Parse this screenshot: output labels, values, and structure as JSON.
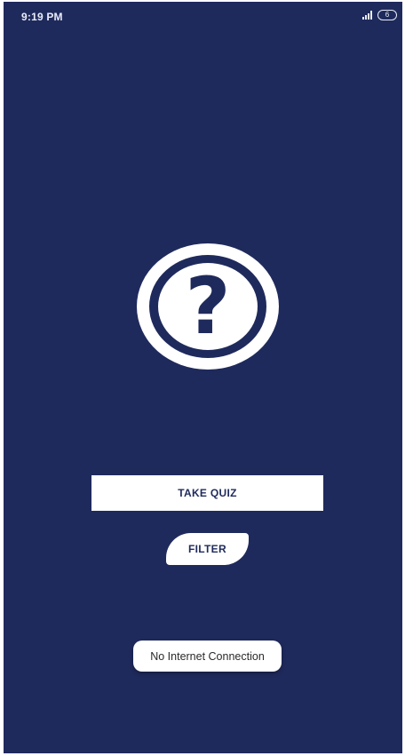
{
  "status_bar": {
    "time": "9:19 PM",
    "battery_level": "6",
    "signal_icon": "signal-bars-icon",
    "battery_icon": "battery-icon"
  },
  "logo": {
    "icon": "question-mark-icon",
    "glyph": "?"
  },
  "actions": {
    "take_quiz_label": "TAKE QUIZ",
    "filter_label": "FILTER"
  },
  "toast": {
    "message": "No Internet Connection"
  },
  "colors": {
    "background": "#1f2a5c",
    "button_background": "#ffffff",
    "button_text": "#1f2a5c"
  }
}
